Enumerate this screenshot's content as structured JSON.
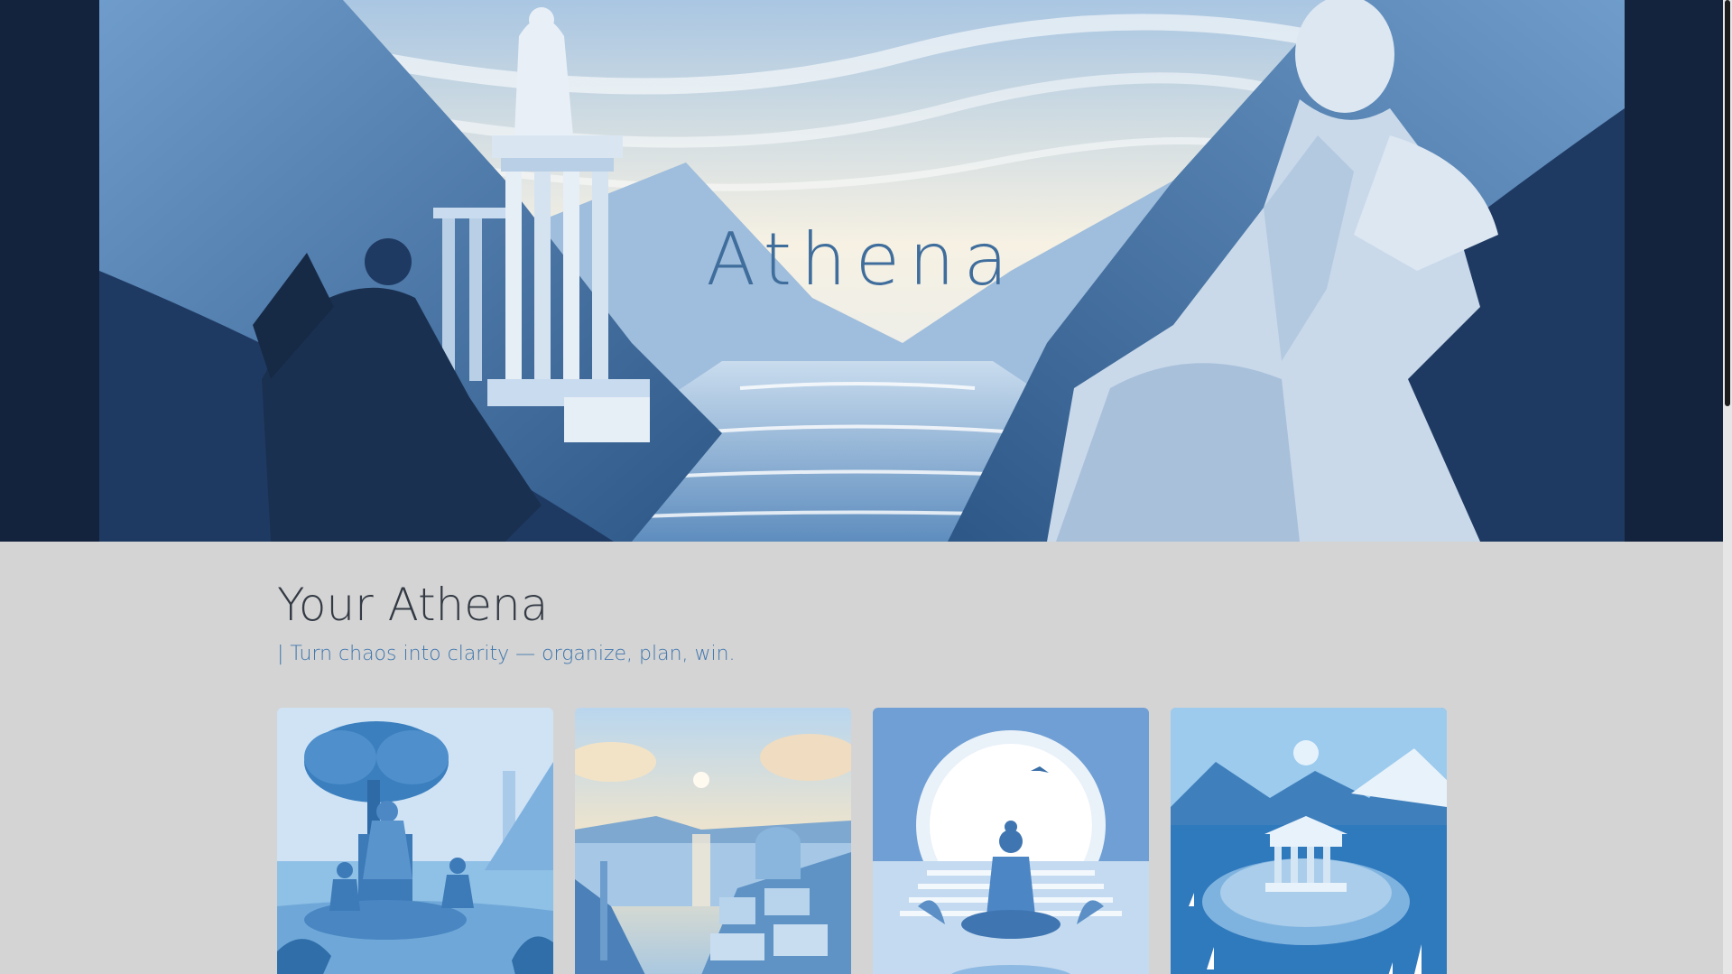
{
  "hero": {
    "title": "Athena"
  },
  "section": {
    "heading": "Your Athena",
    "tagline": "| Turn chaos into clarity — organize, plan, win."
  },
  "cards": [
    {
      "icon": "athena-tree-throne-image"
    },
    {
      "icon": "coastal-city-sunset-image"
    },
    {
      "icon": "meditation-figure-image"
    },
    {
      "icon": "island-temple-image"
    }
  ],
  "colors": {
    "page_background": "#d4d4d4",
    "hero_dark": "#14233d",
    "accent_blue": "#3f76ad",
    "heading_text": "#333a44"
  }
}
